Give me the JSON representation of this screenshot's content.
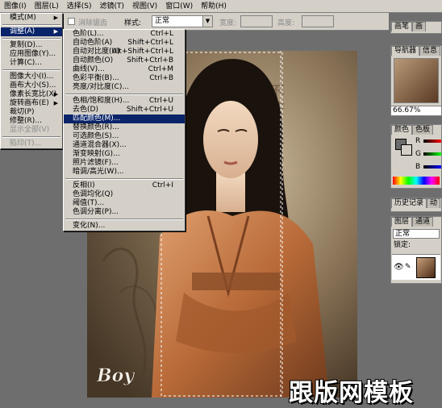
{
  "menubar": [
    "图像(I)",
    "图层(L)",
    "选择(S)",
    "滤镜(T)",
    "视图(V)",
    "窗口(W)",
    "帮助(H)"
  ],
  "options_bar": {
    "antialias_label": "消除锯齿",
    "style_label": "样式:",
    "style_value": "正常",
    "width_label": "宽度:",
    "height_label": "高度:"
  },
  "image_menu": {
    "items": [
      {
        "label": "模式(M)",
        "submenu": true
      },
      {
        "separator": true
      },
      {
        "label": "调整(A)",
        "submenu": true,
        "selected": true
      },
      {
        "separator": true
      },
      {
        "label": "复制(D)..."
      },
      {
        "label": "应用图像(Y)..."
      },
      {
        "label": "计算(C)..."
      },
      {
        "separator": true
      },
      {
        "label": "图像大小(I)..."
      },
      {
        "label": "画布大小(S)..."
      },
      {
        "label": "像素长宽比(X)",
        "submenu": true
      },
      {
        "label": "旋转画布(E)",
        "submenu": true
      },
      {
        "label": "裁切(P)"
      },
      {
        "label": "修整(R)..."
      },
      {
        "label": "显示全部(V)",
        "disabled": true
      },
      {
        "separator": true
      },
      {
        "label": "陷印(T)...",
        "disabled": true
      }
    ]
  },
  "adjust_menu": {
    "items": [
      {
        "label": "色阶(L)...",
        "shortcut": "Ctrl+L"
      },
      {
        "label": "自动色阶(A)",
        "shortcut": "Shift+Ctrl+L"
      },
      {
        "label": "自动对比度(U)",
        "shortcut": "Alt+Shift+Ctrl+L"
      },
      {
        "label": "自动颜色(O)",
        "shortcut": "Shift+Ctrl+B"
      },
      {
        "label": "曲线(V)...",
        "shortcut": "Ctrl+M"
      },
      {
        "label": "色彩平衡(B)...",
        "shortcut": "Ctrl+B"
      },
      {
        "label": "亮度/对比度(C)..."
      },
      {
        "separator": true
      },
      {
        "label": "色相/饱和度(H)...",
        "shortcut": "Ctrl+U"
      },
      {
        "label": "去色(D)",
        "shortcut": "Shift+Ctrl+U"
      },
      {
        "label": "匹配颜色(M)...",
        "selected": true
      },
      {
        "label": "替换颜色(R)..."
      },
      {
        "label": "可选颜色(S)..."
      },
      {
        "label": "通道混合器(X)..."
      },
      {
        "label": "渐变映射(G)..."
      },
      {
        "label": "照片滤镜(F)..."
      },
      {
        "label": "暗调/高光(W)..."
      },
      {
        "separator": true
      },
      {
        "label": "反相(I)",
        "shortcut": "Ctrl+I"
      },
      {
        "label": "色调均化(Q)"
      },
      {
        "label": "阈值(T)..."
      },
      {
        "label": "色调分离(P)..."
      },
      {
        "separator": true
      },
      {
        "label": "变化(N)..."
      }
    ]
  },
  "right_panels": {
    "top_tabs": [
      "画笔",
      "画"
    ],
    "navigator_tabs": [
      "导航器",
      "信息"
    ],
    "zoom": "66.67%",
    "color_tabs": [
      "颜色",
      "色板"
    ],
    "rgb_labels": [
      "R",
      "G",
      "B"
    ],
    "history_tabs": [
      "历史记录",
      "动"
    ],
    "layer_tabs": [
      "图层",
      "通道"
    ],
    "blend_mode": "正常",
    "lock_label": "锁定:"
  },
  "canvas": {
    "signature_text": "Boy",
    "calligraphy_text": "不苦月清宝吉吹台"
  },
  "watermark": "跟版网模板",
  "colors": {
    "selection": "#0a246a",
    "menu_face": "#d4d0c8",
    "workspace": "#6e6e6e"
  }
}
